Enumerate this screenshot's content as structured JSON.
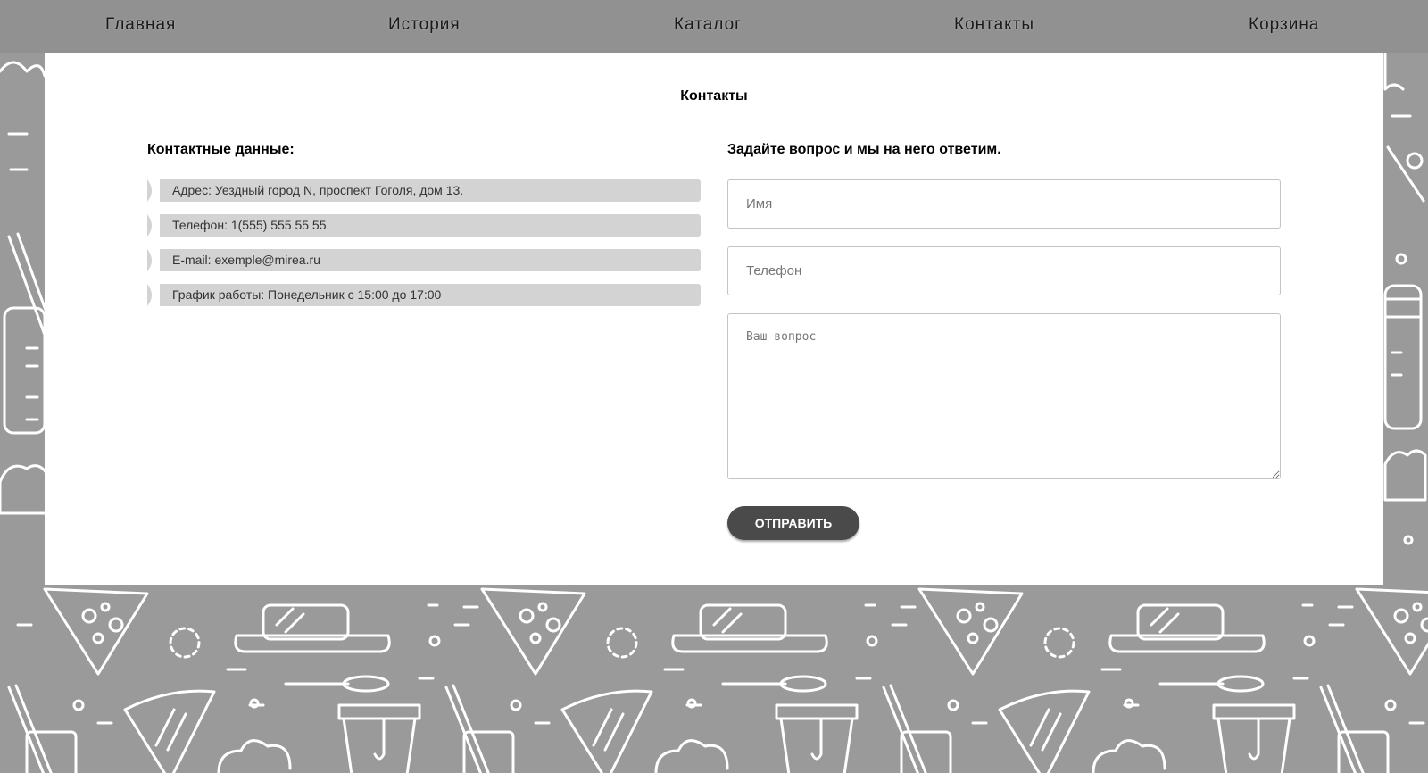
{
  "nav": {
    "items": [
      {
        "label": "Главная"
      },
      {
        "label": "История"
      },
      {
        "label": "Каталог"
      },
      {
        "label": "Контакты"
      },
      {
        "label": "Корзина"
      }
    ]
  },
  "page": {
    "title": "Контакты"
  },
  "contacts": {
    "heading": "Контактные данные:",
    "rows": [
      {
        "text": "Адрес: Уездный город N, проспект Гоголя, дом 13."
      },
      {
        "text": "Телефон: 1(555) 555 55 55"
      },
      {
        "text": "E-mail: exemple@mirea.ru"
      },
      {
        "text": "График работы: Понедельник с 15:00 до 17:00"
      }
    ]
  },
  "form": {
    "heading": "Задайте вопрос и мы на него ответим.",
    "name_placeholder": "Имя",
    "phone_placeholder": "Телефон",
    "question_placeholder": "Ваш вопрос",
    "submit_label": "ОТПРАВИТЬ"
  },
  "colors": {
    "nav_bg": "#919191",
    "page_bg": "#9a9a9a",
    "card_bg": "#ffffff",
    "info_row_bg": "#d3d3d3",
    "button_bg": "#4a4a4a"
  }
}
